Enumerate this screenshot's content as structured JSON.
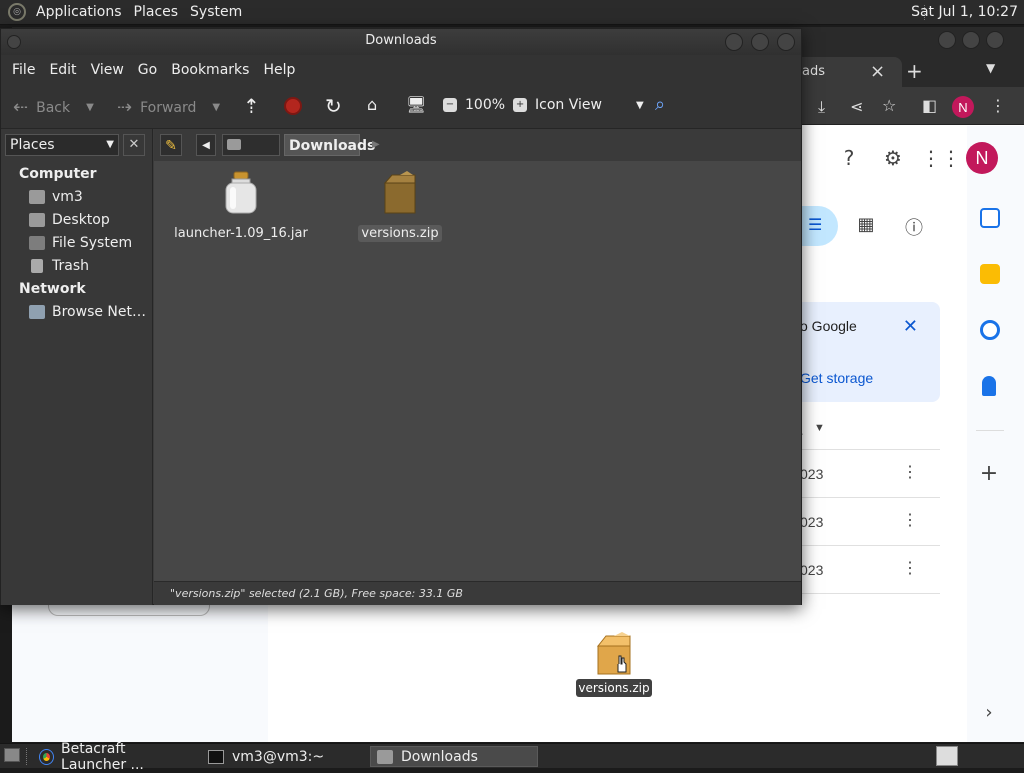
{
  "top_panel": {
    "menus": [
      "Applications",
      "Places",
      "System"
    ],
    "clock": "Sat Jul 1, 10:27"
  },
  "browser": {
    "tab_partial": "ads",
    "tab_close": "×",
    "new_tab": "+",
    "avatar_letter": "N",
    "storage_card": {
      "message_partial": "o Google",
      "link_partial": "Get storage"
    },
    "sort_partial": "...",
    "rows": [
      "023",
      "023",
      "023"
    ]
  },
  "dragged_file": {
    "label": "versions.zip"
  },
  "file_manager": {
    "title": "Downloads",
    "menus": [
      "File",
      "Edit",
      "View",
      "Go",
      "Bookmarks",
      "Help"
    ],
    "toolbar": {
      "back": "Back",
      "forward": "Forward",
      "zoom": "100%",
      "view_mode": "Icon View"
    },
    "places": {
      "header": "Places",
      "sections": [
        {
          "heading": "Computer",
          "items": [
            "vm3",
            "Desktop",
            "File System",
            "Trash"
          ]
        },
        {
          "heading": "Network",
          "items": [
            "Browse Net…"
          ]
        }
      ]
    },
    "path": [
      "vm3",
      "Downloads"
    ],
    "files": [
      {
        "name": "launcher-1.09_16.jar",
        "type": "jar",
        "selected": false
      },
      {
        "name": "versions.zip",
        "type": "zip",
        "selected": true
      }
    ],
    "status": "\"versions.zip\" selected (2.1 GB), Free space: 33.1 GB"
  },
  "taskbar": {
    "tasks": [
      {
        "label": "Betacraft Launcher ...",
        "icon": "chrome-icon"
      },
      {
        "label": "vm3@vm3:~",
        "icon": "terminal-icon"
      },
      {
        "label": "Downloads",
        "icon": "folder-icon"
      }
    ]
  }
}
